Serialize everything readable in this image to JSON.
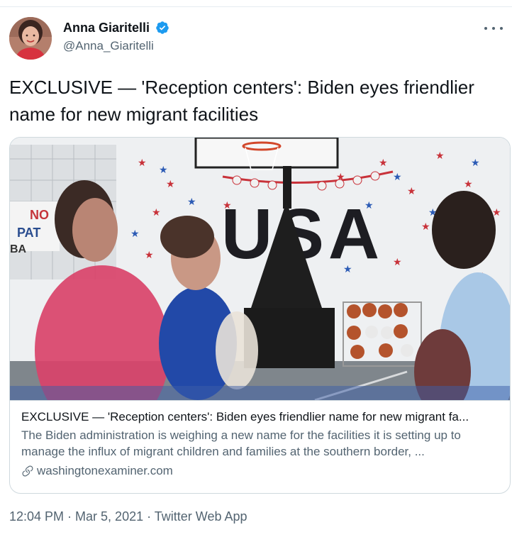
{
  "author": {
    "display_name": "Anna Giaritelli",
    "handle": "@Anna_Giaritelli",
    "verified": true
  },
  "tweet": {
    "text": "EXCLUSIVE — 'Reception centers': Biden eyes friendlier name for new migrant facilities"
  },
  "card": {
    "title": "EXCLUSIVE — 'Reception centers': Biden eyes friendlier name for new migrant fa...",
    "description": "The Biden administration is weighing a new name for the facilities it is setting up to manage the influx of migrant children and families at the southern border, ...",
    "domain": "washingtonexaminer.com",
    "image_text": {
      "usa": "USA",
      "sign_line1": "NO",
      "sign_line2": "PAT",
      "sign_line3": "BA"
    }
  },
  "footer": {
    "time": "12:04 PM",
    "separator1": " · ",
    "date": "Mar 5, 2021",
    "separator2": " · ",
    "source": "Twitter Web App"
  },
  "colors": {
    "text_primary": "#0f1419",
    "text_secondary": "#536471",
    "verified_blue": "#1d9bf0",
    "border": "#cfd9de"
  },
  "icons": {
    "verified": "verified-badge-icon",
    "more": "more-options-icon",
    "link": "link-icon"
  }
}
